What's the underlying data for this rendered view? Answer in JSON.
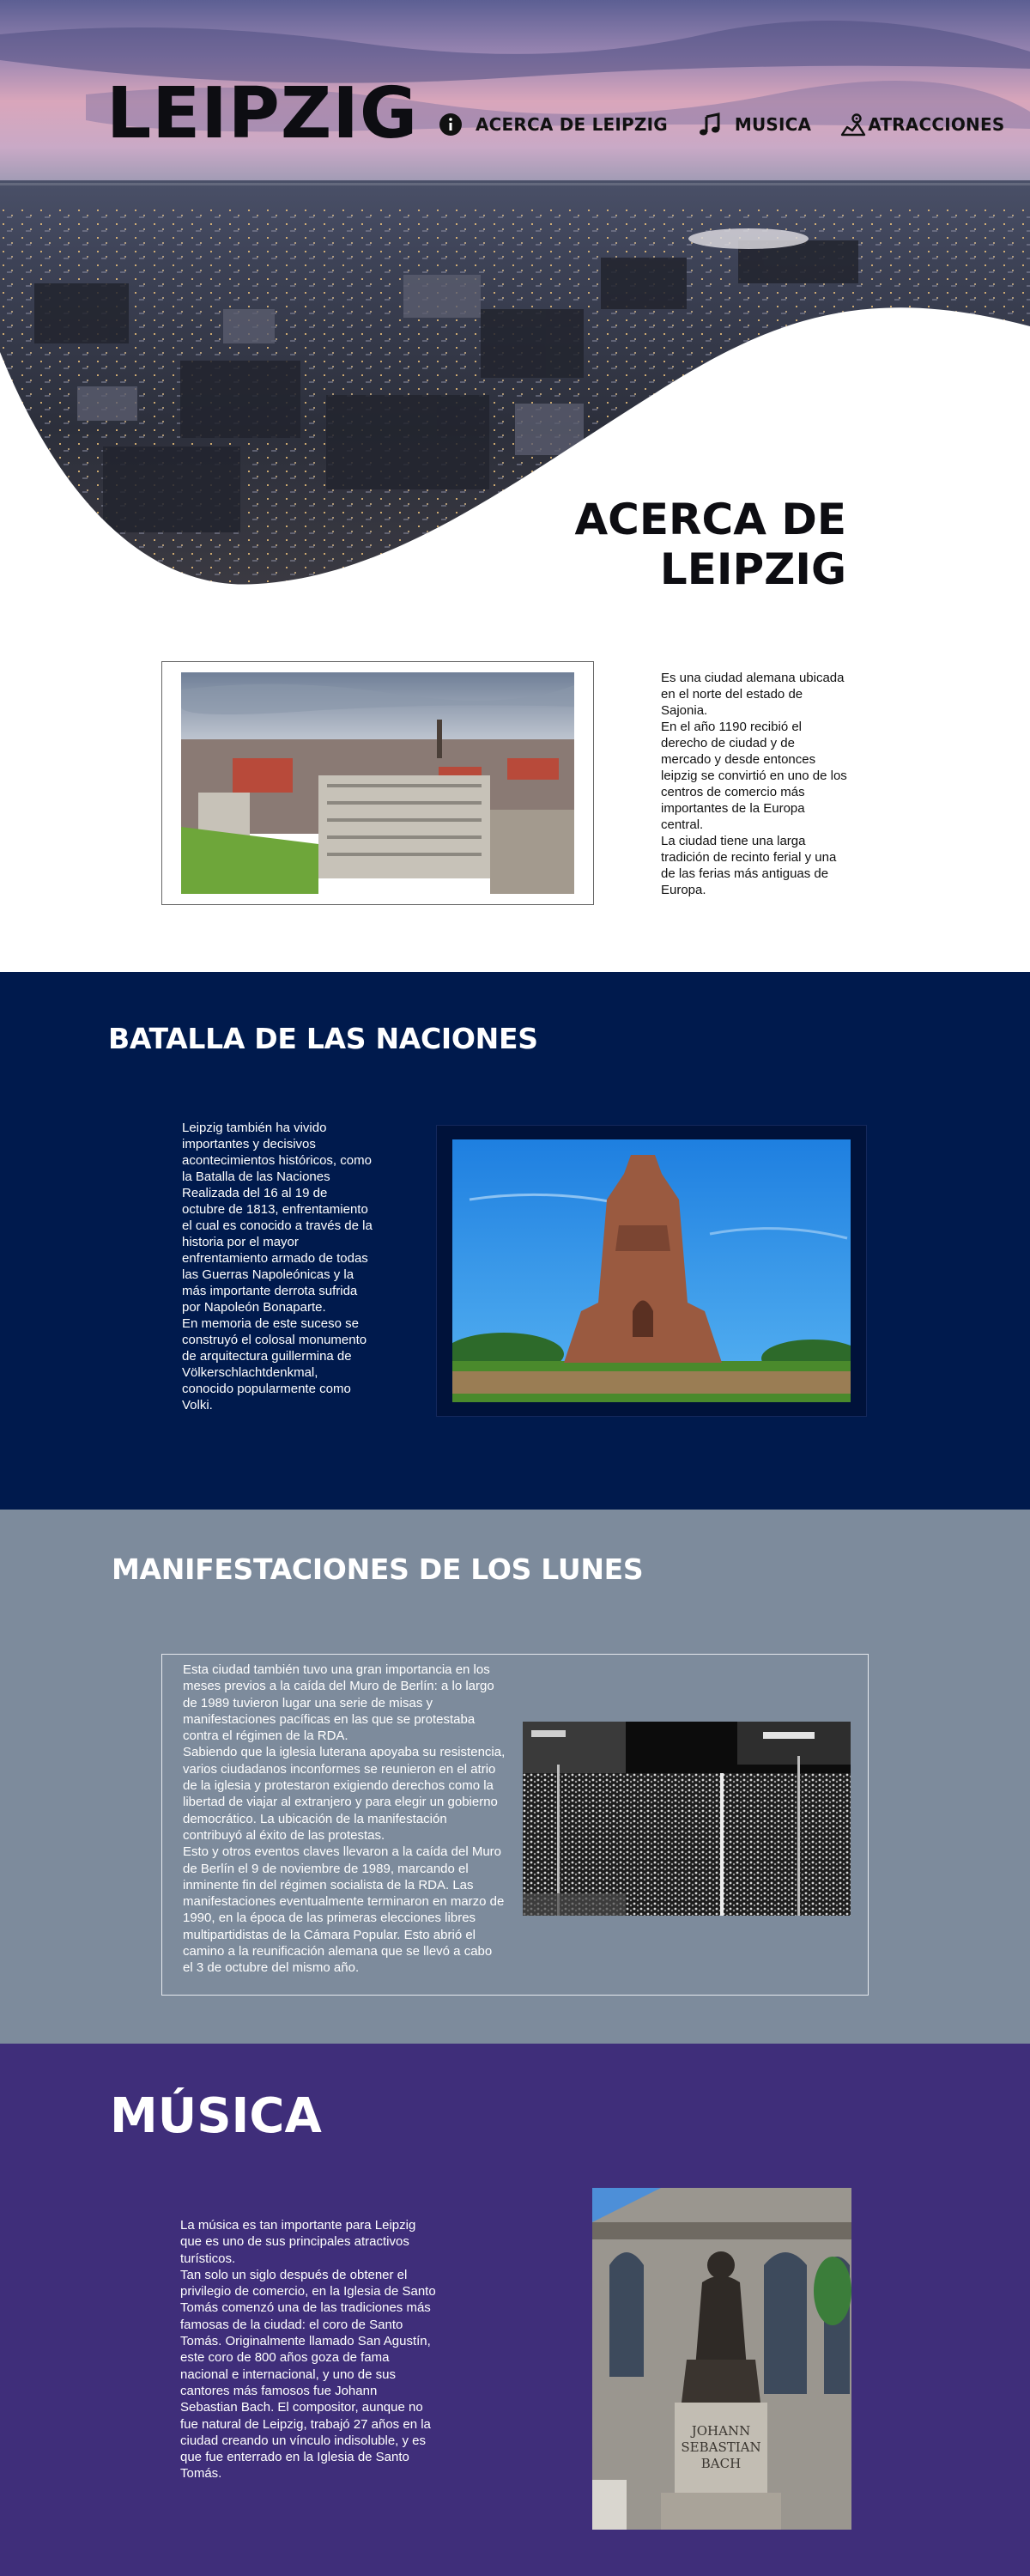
{
  "header": {
    "logo": "LEIPZIG",
    "nav": [
      {
        "label": "ACERCA DE LEIPZIG",
        "icon": "info-icon"
      },
      {
        "label": "MUSICA",
        "icon": "music-note-icon"
      },
      {
        "label": "ATRACCIONES",
        "icon": "map-pin-icon"
      }
    ]
  },
  "about": {
    "title_line1": "ACERCA DE",
    "title_line2": "LEIPZIG",
    "paragraphs": [
      "Es una ciudad alemana ubicada en el norte del estado de Sajonia.",
      "En el año 1190 recibió el derecho de ciudad y de mercado y desde entonces leipzig se convirtió en uno de los centros de comercio más importantes de la Europa central.",
      "La ciudad tiene una larga tradición de recinto ferial y una de las ferias más antiguas de Europa."
    ]
  },
  "batalla": {
    "title": "BATALLA DE LAS NACIONES",
    "paragraphs": [
      "Leipzig también ha vivido importantes y decisivos acontecimientos históricos, como la Batalla de las Naciones Realizada del 16 al 19 de octubre de 1813, enfrentamiento el cual es conocido a través de la historia por el mayor enfrentamiento armado de todas las Guerras Napoleónicas y la más importante derrota sufrida por Napoleón Bonaparte.",
      "En memoria de este suceso se construyó el colosal monumento de arquitectura guillermina de Völkerschlachtdenkmal, conocido popularmente como Volki."
    ]
  },
  "manifestaciones": {
    "title": "MANIFESTACIONES DE LOS LUNES",
    "paragraphs": [
      "Esta ciudad también tuvo una gran importancia en los meses previos a la caída del Muro de Berlín: a lo largo de 1989 tuvieron lugar una serie de misas y manifestaciones pacíficas en las que se protestaba contra el régimen de la RDA.",
      "Sabiendo que la iglesia luterana apoyaba su resistencia, varios ciudadanos inconformes se reunieron en el atrio de la iglesia y protestaron exigiendo derechos como la libertad de viajar al extranjero y para elegir un gobierno democrático. La ubicación de la manifestación contribuyó al éxito de las protestas.",
      "Esto y otros eventos claves llevaron a la caída del Muro de Berlín el 9 de noviembre de 1989, marcando el inminente fin del régimen socialista de la RDA. Las manifestaciones eventualmente terminaron en marzo de 1990, en la época de las primeras elecciones libres multipartidistas de la Cámara Popular. Esto abrió el camino a la reunificación alemana que se llevó a cabo el 3 de octubre del mismo año."
    ]
  },
  "musica": {
    "title": "MÚSICA",
    "paragraphs": [
      "La música es tan importante para Leipzig que es uno de sus principales atractivos turísticos.",
      "Tan solo un siglo después de obtener el privilegio de comercio, en la Iglesia de Santo Tomás comenzó una de las tradiciones más famosas de la ciudad: el coro de Santo Tomás. Originalmente llamado San Agustín, este coro de 800 años goza de fama nacional e internacional, y uno de sus cantores más famosos fue Johann Sebastian Bach. El compositor, aunque no fue natural de Leipzig, trabajó 27 años en la ciudad creando un vínculo indisoluble, y es que fue enterrado en la Iglesia de Santo Tomás."
    ],
    "statue_inscription": [
      "JOHANN",
      "SEBASTIAN",
      "BACH"
    ]
  },
  "colors": {
    "batalla_bg": "#001a4d",
    "manif_bg": "#7d8b9c",
    "musica_bg": "#3f2e7a",
    "text_dark": "#0d0d12"
  }
}
